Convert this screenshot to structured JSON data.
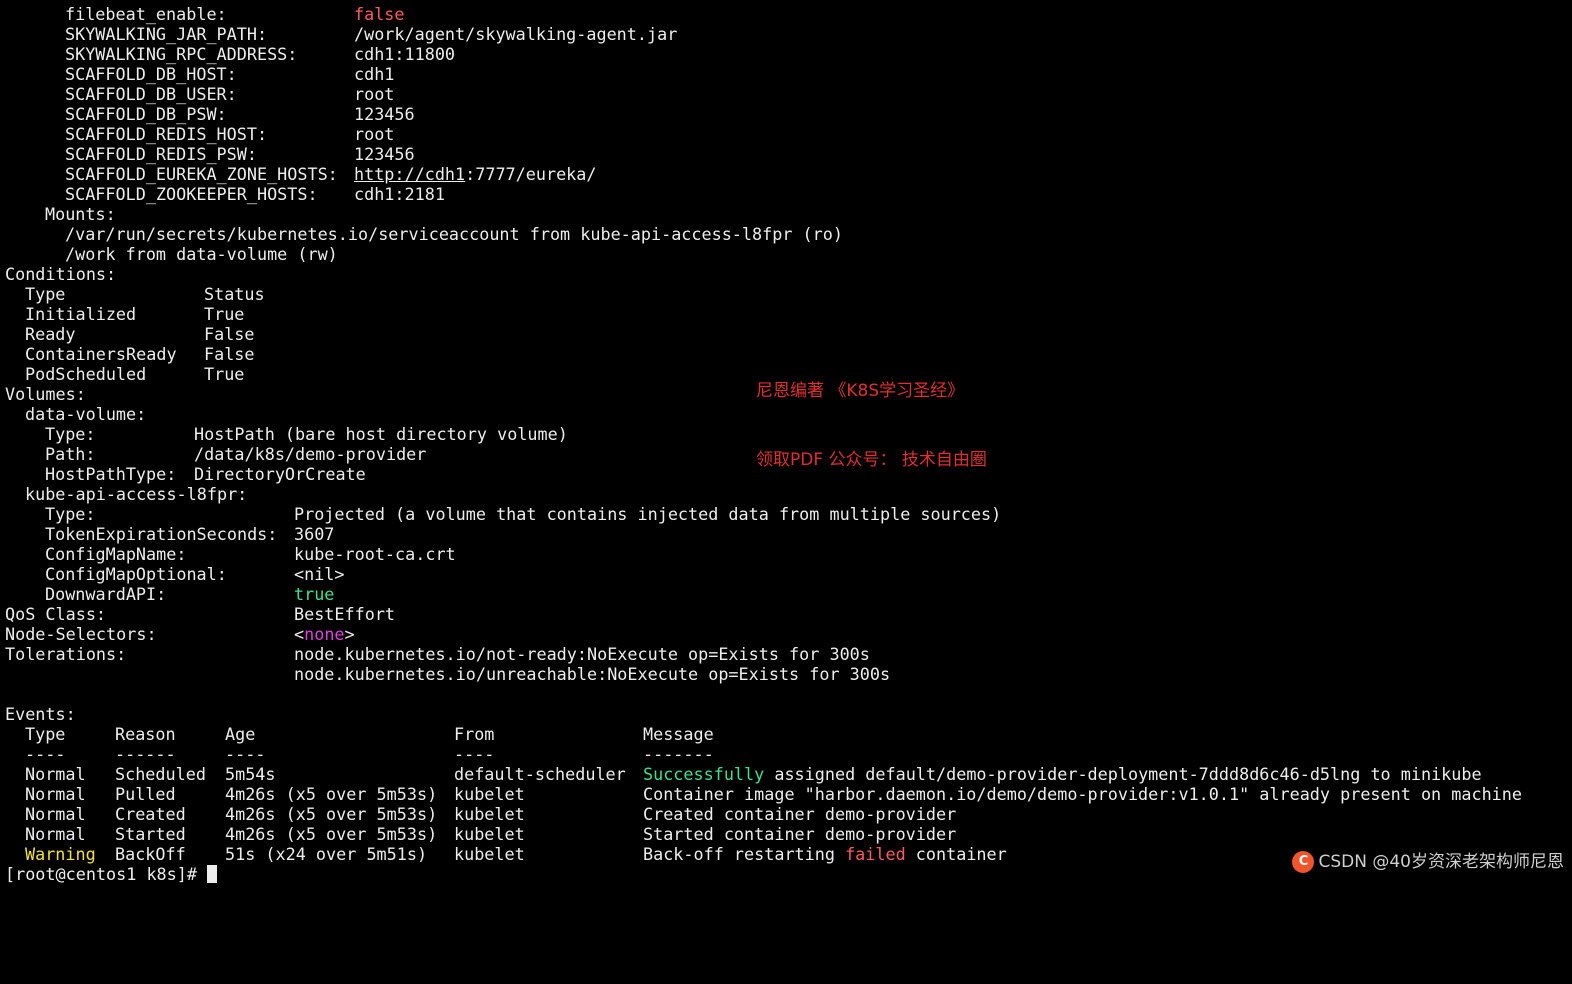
{
  "env": {
    "rows": [
      {
        "key": "filebeat_enable:",
        "value": "false"
      },
      {
        "key": "SKYWALKING_JAR_PATH:",
        "value": "/work/agent/skywalking-agent.jar"
      },
      {
        "key": "SKYWALKING_RPC_ADDRESS:",
        "value": "cdh1:11800"
      },
      {
        "key": "SCAFFOLD_DB_HOST:",
        "value": "cdh1"
      },
      {
        "key": "SCAFFOLD_DB_USER:",
        "value": "root"
      },
      {
        "key": "SCAFFOLD_DB_PSW:",
        "value": "123456"
      },
      {
        "key": "SCAFFOLD_REDIS_HOST:",
        "value": "root"
      },
      {
        "key": "SCAFFOLD_REDIS_PSW:",
        "value": "123456"
      },
      {
        "key": "SCAFFOLD_EUREKA_ZONE_HOSTS:",
        "value_link": "http://cdh1",
        "value_rest": ":7777/eureka/"
      },
      {
        "key": "SCAFFOLD_ZOOKEEPER_HOSTS:",
        "value": "cdh1:2181"
      }
    ]
  },
  "mounts": {
    "label": "Mounts:",
    "items": [
      "/var/run/secrets/kubernetes.io/serviceaccount from kube-api-access-l8fpr (ro)",
      "/work from data-volume (rw)"
    ]
  },
  "conditions": {
    "label": "Conditions:",
    "header": {
      "type": "Type",
      "status": "Status"
    },
    "rows": [
      {
        "type": "Initialized",
        "status": "True"
      },
      {
        "type": "Ready",
        "status": "False"
      },
      {
        "type": "ContainersReady",
        "status": "False"
      },
      {
        "type": "PodScheduled",
        "status": "True"
      }
    ]
  },
  "volumes": {
    "label": "Volumes:",
    "data_volume": {
      "name": "data-volume:",
      "rows": [
        {
          "key": "Type:",
          "value": "HostPath (bare host directory volume)"
        },
        {
          "key": "Path:",
          "value": "/data/k8s/demo-provider"
        },
        {
          "key": "HostPathType:",
          "value": "DirectoryOrCreate"
        }
      ]
    },
    "kube_api": {
      "name": "kube-api-access-l8fpr:",
      "rows": [
        {
          "key": "Type:",
          "value": "Projected (a volume that contains injected data from multiple sources)"
        },
        {
          "key": "TokenExpirationSeconds:",
          "value": "3607"
        },
        {
          "key": "ConfigMapName:",
          "value": "kube-root-ca.crt"
        },
        {
          "key": "ConfigMapOptional:",
          "value": "<nil>"
        },
        {
          "key": "DownwardAPI:",
          "value": "true"
        }
      ]
    }
  },
  "qos": {
    "key": "QoS Class:",
    "value": "BestEffort"
  },
  "node_selectors": {
    "key": "Node-Selectors:",
    "prefix": "<",
    "value": "none",
    "suffix": ">"
  },
  "tolerations": {
    "key": "Tolerations:",
    "values": [
      "node.kubernetes.io/not-ready:NoExecute op=Exists for 300s",
      "node.kubernetes.io/unreachable:NoExecute op=Exists for 300s"
    ]
  },
  "events": {
    "label": "Events:",
    "header": {
      "type": "Type",
      "reason": "Reason",
      "age": "Age",
      "from": "From",
      "message": "Message"
    },
    "divider": {
      "type": "----",
      "reason": "------",
      "age": "----",
      "from": "----",
      "message": "-------"
    },
    "rows": [
      {
        "type": "Normal",
        "reason": "Scheduled",
        "age": "5m54s",
        "from": "default-scheduler",
        "msg_pre": "",
        "msg_hl": "Successfully",
        "msg_post": " assigned default/demo-provider-deployment-7ddd8d6c46-d5lng to minikube"
      },
      {
        "type": "Normal",
        "reason": "Pulled",
        "age": "4m26s (x5 over 5m53s)",
        "from": "kubelet",
        "msg_pre": "Container image \"harbor.daemon.io/demo/demo-provider:v1.0.1\" already present on machine",
        "msg_hl": "",
        "msg_post": ""
      },
      {
        "type": "Normal",
        "reason": "Created",
        "age": "4m26s (x5 over 5m53s)",
        "from": "kubelet",
        "msg_pre": "Created container demo-provider",
        "msg_hl": "",
        "msg_post": ""
      },
      {
        "type": "Normal",
        "reason": "Started",
        "age": "4m26s (x5 over 5m53s)",
        "from": "kubelet",
        "msg_pre": "Started container demo-provider",
        "msg_hl": "",
        "msg_post": ""
      },
      {
        "type": "Warning",
        "reason": "BackOff",
        "age": "51s (x24 over 5m51s)",
        "from": "kubelet",
        "msg_pre": "Back-off restarting ",
        "msg_hl": "failed",
        "msg_post": " container"
      }
    ]
  },
  "prompt": "[root@centos1 k8s]# ",
  "annotations": [
    "尼恩编著 《K8S学习圣经》",
    "领取PDF 公众号： 技术自由圈"
  ],
  "watermark": {
    "logo": "C",
    "text": "CSDN @40岁资深老架构师尼恩"
  },
  "colors": {
    "background": "#000000",
    "text": "#ededed",
    "red": "#ff5b5b",
    "green": "#3fe08a",
    "magenta": "#e040e0",
    "yellow": "#f0e040",
    "annotation": "#e03030"
  }
}
